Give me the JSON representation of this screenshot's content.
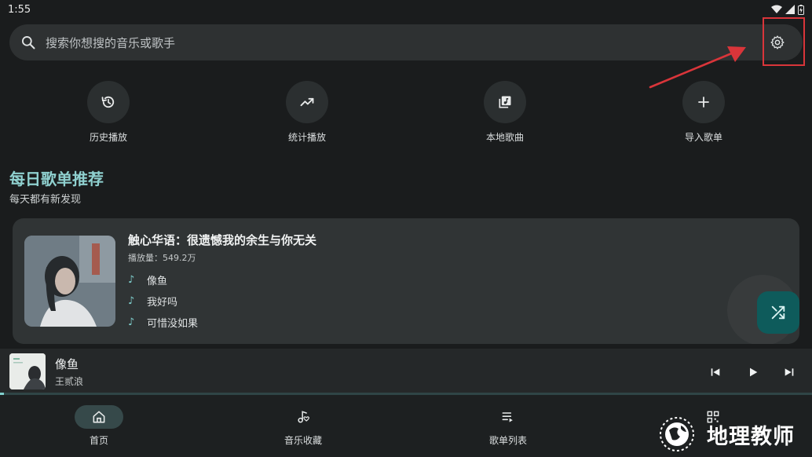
{
  "status": {
    "time": "1:55"
  },
  "search": {
    "placeholder": "搜索你想搜的音乐或歌手"
  },
  "quick_actions": [
    {
      "label": "历史播放",
      "icon": "history-icon"
    },
    {
      "label": "统计播放",
      "icon": "trending-up-icon"
    },
    {
      "label": "本地歌曲",
      "icon": "library-music-icon"
    },
    {
      "label": "导入歌单",
      "icon": "plus-icon"
    }
  ],
  "section": {
    "title": "每日歌单推荐",
    "subtitle": "每天都有新发现"
  },
  "playlist": {
    "title": "触心华语：很遗憾我的余生与你无关",
    "plays": "播放量：549.2万",
    "tracks": [
      "像鱼",
      "我好吗",
      "可惜没如果"
    ]
  },
  "now_playing": {
    "title": "像鱼",
    "artist": "王贰浪",
    "progress": 0.005
  },
  "nav": [
    {
      "label": "首页",
      "active": true
    },
    {
      "label": "音乐收藏",
      "active": false
    },
    {
      "label": "歌单列表",
      "active": false
    }
  ],
  "watermark": {
    "text": "地理教师"
  },
  "colors": {
    "accent": "#7fcfcd",
    "highlight": "#d9353a",
    "background": "#1a1c1d"
  }
}
